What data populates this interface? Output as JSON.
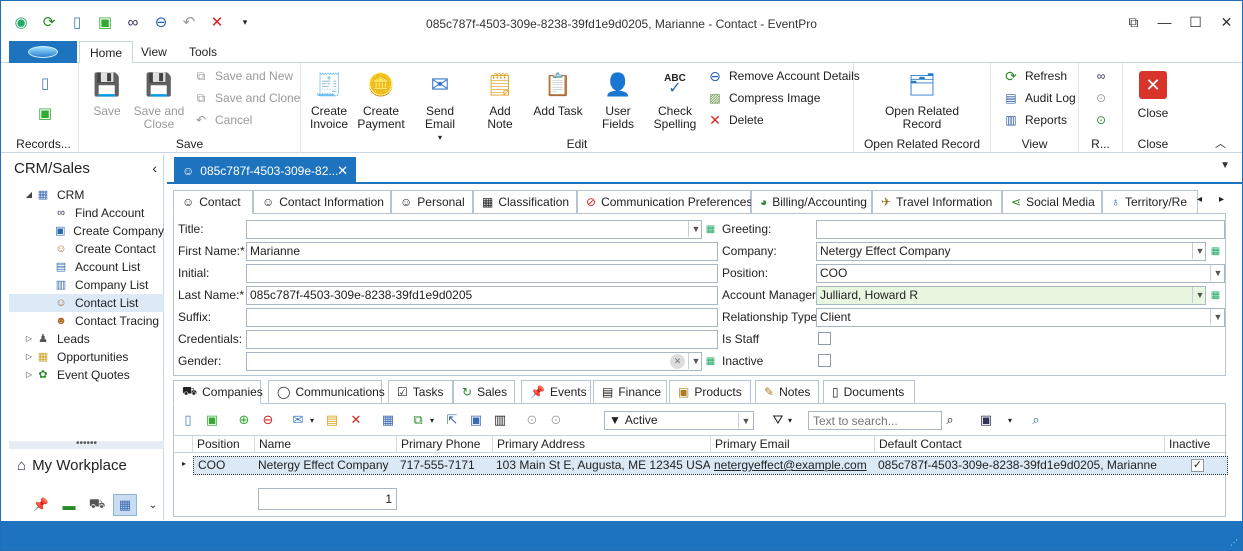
{
  "window": {
    "title": "085c787f-4503-309e-8238-39fd1e9d0205, Marianne - Contact - EventPro"
  },
  "menu": {
    "tabs": [
      "Home",
      "View",
      "Tools"
    ]
  },
  "ribbon": {
    "records": {
      "group_label": "Records..."
    },
    "save": {
      "save": "Save",
      "save_and_close": "Save and Close",
      "save_and_new": "Save and New",
      "save_and_clone": "Save and Clone",
      "cancel": "Cancel",
      "group_label": "Save"
    },
    "edit": {
      "create_invoice": "Create Invoice",
      "create_payment": "Create Payment",
      "send_email": "Send Email",
      "add_note": "Add Note",
      "add_task": "Add Task",
      "user_fields": "User Fields",
      "check_spelling": "Check Spelling",
      "spell_icon_text": "ABC",
      "remove_account_details": "Remove Account Details",
      "compress_image": "Compress Image",
      "delete": "Delete",
      "group_label": "Edit"
    },
    "open_related": {
      "open_related_record": "Open Related Record",
      "group_label": "Open Related Record"
    },
    "view": {
      "refresh": "Refresh",
      "audit_log": "Audit Log",
      "reports": "Reports",
      "group_label": "View"
    },
    "r": {
      "group_label": "R..."
    },
    "close": {
      "close": "Close",
      "group_label": "Close"
    }
  },
  "nav": {
    "header": "CRM/Sales",
    "crm": "CRM",
    "crm_items": [
      "Find Account",
      "Create Company",
      "Create Contact",
      "Account List",
      "Company List",
      "Contact List",
      "Contact Tracing"
    ],
    "top_items": [
      "Leads",
      "Opportunities",
      "Event Quotes"
    ],
    "workplace": "My Workplace"
  },
  "doc_tab": {
    "title": "085c787f-4503-309e-82..."
  },
  "tabs": [
    "Contact",
    "Contact Information",
    "Personal",
    "Classification",
    "Communication Preferences",
    "Billing/Accounting",
    "Travel Information",
    "Social Media",
    "Territory/Re"
  ],
  "form": {
    "left": [
      {
        "label": "Title:",
        "value": ""
      },
      {
        "label": "First Name:*",
        "value": "Marianne"
      },
      {
        "label": "Initial:",
        "value": ""
      },
      {
        "label": "Last Name:*",
        "value": "085c787f-4503-309e-8238-39fd1e9d0205"
      },
      {
        "label": "Suffix:",
        "value": ""
      },
      {
        "label": "Credentials:",
        "value": ""
      },
      {
        "label": "Gender:",
        "value": ""
      }
    ],
    "right": [
      {
        "label": "Greeting:",
        "value": ""
      },
      {
        "label": "Company:",
        "value": "Netergy Effect Company"
      },
      {
        "label": "Position:",
        "value": "COO"
      },
      {
        "label": "Account Manager:",
        "value": "Julliard, Howard R"
      },
      {
        "label": "Relationship Type:",
        "value": "Client"
      },
      {
        "label": "Is Staff",
        "value": ""
      },
      {
        "label": "Inactive",
        "value": ""
      }
    ]
  },
  "subtabs": [
    "Companies",
    "Communications",
    "Tasks",
    "Sales",
    "Events",
    "Finance",
    "Products",
    "Notes",
    "Documents"
  ],
  "grid": {
    "filter": "Active",
    "search_placeholder": "Text to search...",
    "columns": [
      "Position",
      "Name",
      "Primary Phone",
      "Primary Address",
      "Primary Email",
      "Default Contact",
      "Inactive"
    ],
    "row": {
      "position": "COO",
      "name": "Netergy Effect Company",
      "phone": "717-555-7171",
      "address": "103 Main St E, Augusta, ME 12345 USA",
      "email": "netergyeffect@example.com",
      "default_contact": "085c787f-4503-309e-8238-39fd1e9d0205, Marianne",
      "inactive_mark": "✓"
    },
    "count": "1"
  }
}
